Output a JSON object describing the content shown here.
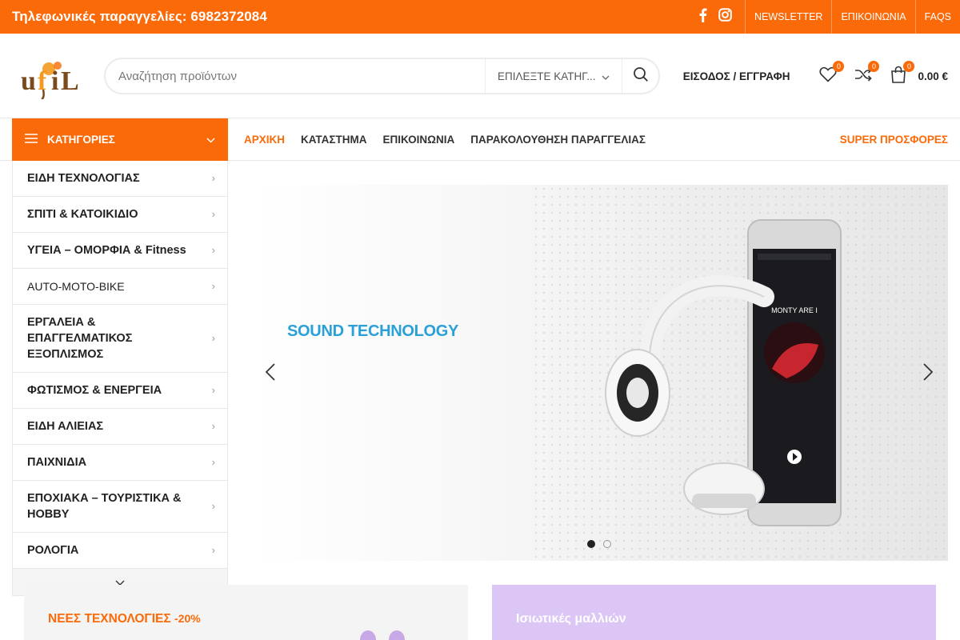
{
  "topbar": {
    "phone_text": "Τηλεφωνικές παραγγελίες: 6982372084",
    "social": [
      "facebook-icon",
      "instagram-icon"
    ],
    "links": [
      "NEWSLETTER",
      "ΕΠΙΚΟΙΝΩΝΙΑ",
      "FAQS"
    ]
  },
  "header": {
    "logo_text": "ufil",
    "search_placeholder": "Αναζήτηση προϊόντων",
    "category_select": "ΕΠΙΛΕΞΤΕ ΚΑΤΗΓ...",
    "login_label": "ΕΙΣΟΔΟΣ / ΕΓΓΡΑΦΗ",
    "wishlist_count": "0",
    "compare_count": "0",
    "cart_count": "0",
    "cart_total": "0.00 €"
  },
  "nav": {
    "categories_label": "ΚΑΤΗΓΟΡΙΕΣ",
    "menu": [
      "ΑΡΧΙΚΗ",
      "ΚΑΤΑΣΤΗΜΑ",
      "ΕΠΙΚΟΙΝΩΝΙΑ",
      "ΠΑΡΑΚΟΛΟΥΘΗΣΗ ΠΑΡΑΓΓΕΛΙΑΣ"
    ],
    "super_offers": "SUPER ΠΡΟΣΦΟΡΕΣ"
  },
  "categories": [
    "ΕΙΔΗ ΤΕΧΝΟΛΟΓΙΑΣ",
    "ΣΠΙΤΙ & ΚΑΤΟΙΚΙΔΙΟ",
    "ΥΓΕΙΑ – ΟΜΟΡΦΙΑ & Fitness",
    "AUTO-MOTO-BIKE",
    "ΕΡΓΑΛΕΙΑ & ΕΠΑΓΓΕΛΜΑΤΙΚΟΣ ΕΞΟΠΛΙΣΜΟΣ",
    "ΦΩΤΙΣΜΟΣ & ΕΝΕΡΓΕΙΑ",
    "ΕΙΔΗ ΑΛΙΕΙΑΣ",
    "ΠΑΙΧΝΙΔΙΑ",
    "ΕΠΟΧΙΑΚΑ – ΤΟΥΡΙΣΤΙΚΑ & HOBBY",
    "ΡΟΛΟΓΙΑ"
  ],
  "slider": {
    "title": "SOUND TECHNOLOGY",
    "phone_screen_title": "MONTY ARE I",
    "active_slide": 1,
    "total_slides": 2
  },
  "promos": {
    "left_title": "ΝΕΕΣ ΤΕΧΝΟΛΟΓΙΕΣ",
    "left_discount": "-20%",
    "right_title": "Ισιωτικές μαλλιών"
  },
  "colors": {
    "brand": "#fb6a09",
    "accent_blue": "#2aa0d9",
    "promo_lilac": "#dbc6f5"
  }
}
